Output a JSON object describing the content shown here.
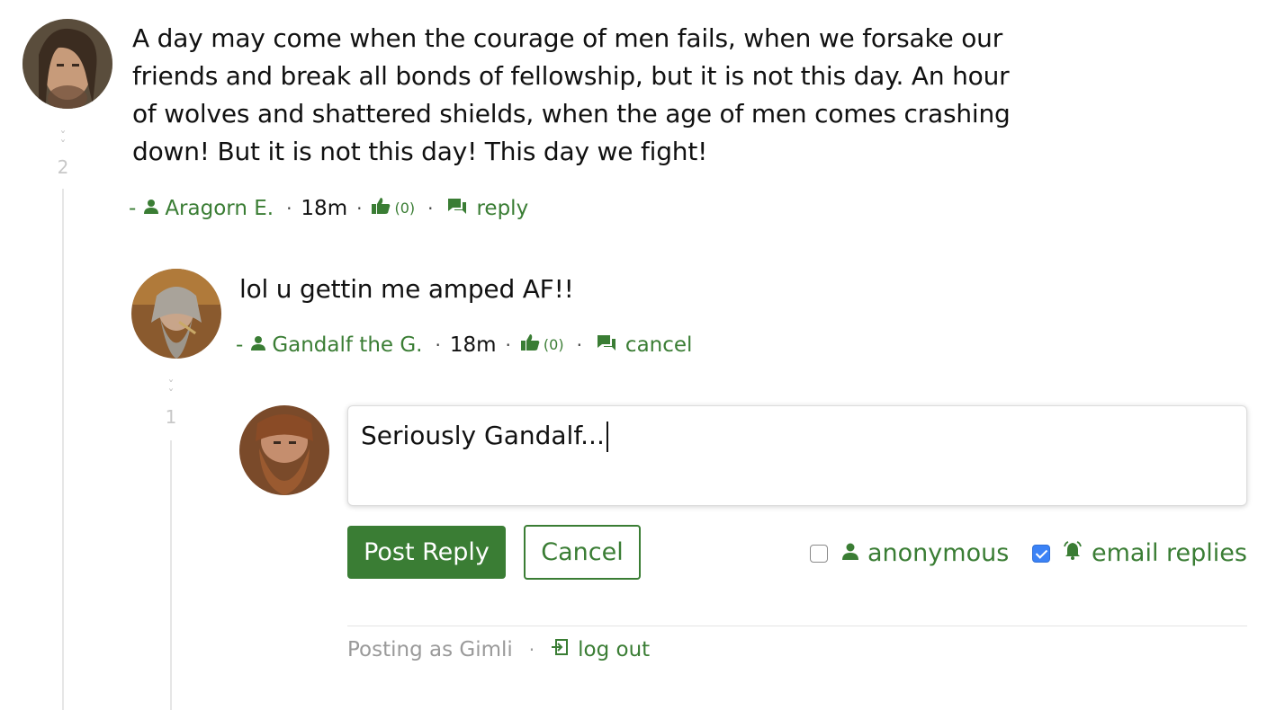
{
  "comment1": {
    "text": "A day may come when the courage of men fails, when we forsake our friends and break all bonds of fellowship, but it is not this day. An hour of wolves and shattered shields, when the age of men comes crashing down! But it is not this day! This day we fight!",
    "author_prefix": "-",
    "author": "Aragorn E.",
    "time": "18m",
    "likes": "(0)",
    "action": "reply",
    "vote_count": "2"
  },
  "comment2": {
    "text": "lol u gettin me amped AF!!",
    "author_prefix": "-",
    "author": "Gandalf the G.",
    "time": "18m",
    "likes": "(0)",
    "action": "cancel",
    "vote_count": "1"
  },
  "reply_form": {
    "value": "Seriously Gandalf...",
    "post_label": "Post Reply",
    "cancel_label": "Cancel",
    "anonymous_label": "anonymous",
    "anonymous_checked": false,
    "email_label": "email replies",
    "email_checked": true,
    "posting_as": "Posting as Gimli",
    "logout_label": "log out"
  },
  "colors": {
    "accent": "#3a7d34",
    "checkbox_checked": "#3b82f6"
  },
  "icons": {
    "user": "user-icon",
    "like": "thumbs-up-icon",
    "reply": "chat-bubbles-icon",
    "bell": "bell-icon",
    "logout": "logout-icon",
    "vote": "chevron-up-icon"
  }
}
